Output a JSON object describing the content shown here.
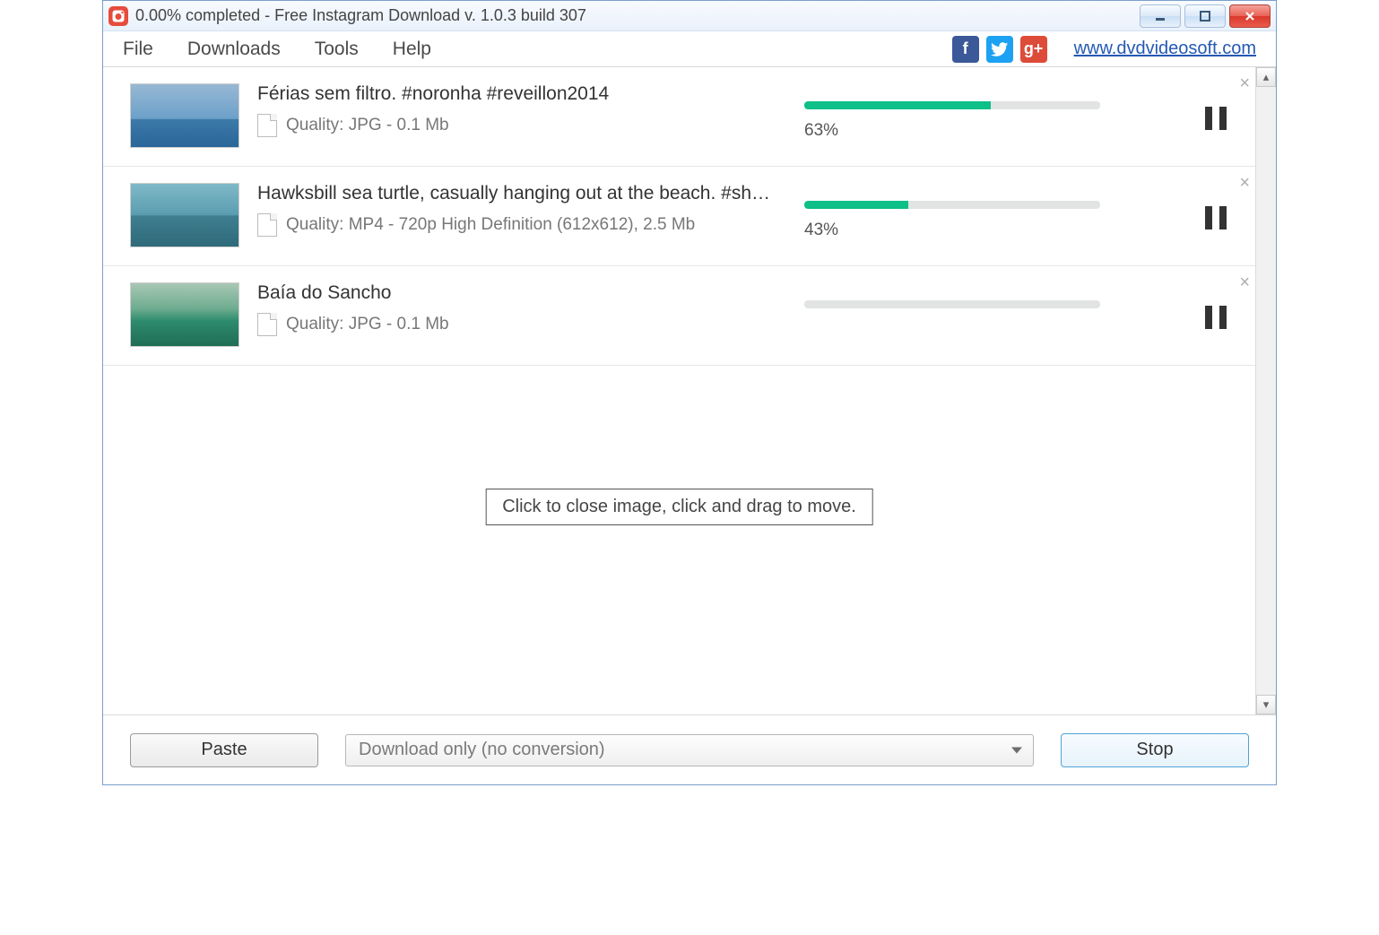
{
  "title": "0.00% completed - Free Instagram Download  v. 1.0.3 build 307",
  "menu": {
    "file": "File",
    "downloads": "Downloads",
    "tools": "Tools",
    "help": "Help"
  },
  "social": {
    "facebook_label": "f",
    "twitter_label": "",
    "google_label": "g+"
  },
  "website_link": "www.dvdvideosoft.com",
  "items": [
    {
      "title": "Férias sem filtro. #noronha #reveillon2014",
      "quality": "Quality: JPG - 0.1 Mb",
      "progress_pct": 63,
      "progress_label": "63%"
    },
    {
      "title": "Hawksbill sea turtle, casually hanging out at the beach. #she...",
      "quality": "Quality: MP4 - 720p High Definition (612x612), 2.5 Mb",
      "progress_pct": 35,
      "progress_label": "43%"
    },
    {
      "title": "Baía do Sancho",
      "quality": "Quality: JPG - 0.1 Mb",
      "progress_pct": 0,
      "progress_label": ""
    }
  ],
  "tooltip": "Click to close image, click and drag to move.",
  "bottom": {
    "paste": "Paste",
    "format": "Download only (no conversion)",
    "stop": "Stop"
  },
  "colors": {
    "progress_fill": "#0ebf87",
    "link": "#2459b3"
  }
}
